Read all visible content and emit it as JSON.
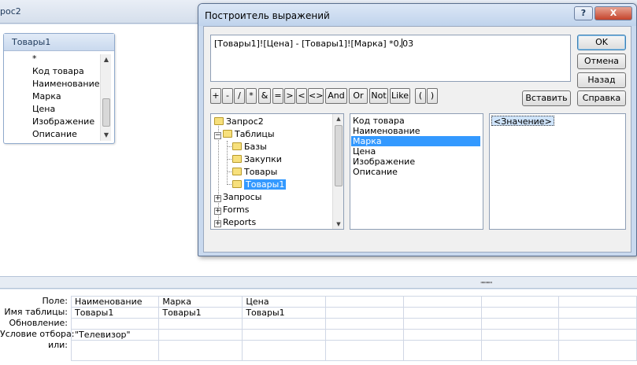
{
  "query_window": {
    "tab_title": "рос2"
  },
  "field_list": {
    "title": "Товары1",
    "items": [
      "*",
      "Код товара",
      "Наименование",
      "Марка",
      "Цена",
      "Изображение",
      "Описание"
    ]
  },
  "design_grid": {
    "row_labels": [
      "Поле:",
      "Имя таблицы:",
      "Обновление:",
      "Условие отбора:",
      "или:"
    ],
    "columns": [
      {
        "field": "Наименование",
        "table": "Товары1",
        "update": "",
        "criteria": "\"Телевизор\"",
        "or": ""
      },
      {
        "field": "Марка",
        "table": "Товары1",
        "update": "",
        "criteria": "",
        "or": ""
      },
      {
        "field": "Цена",
        "table": "Товары1",
        "update": "",
        "criteria": "",
        "or": ""
      },
      {
        "field": "",
        "table": "",
        "update": "",
        "criteria": "",
        "or": ""
      },
      {
        "field": "",
        "table": "",
        "update": "",
        "criteria": "",
        "or": ""
      },
      {
        "field": "",
        "table": "",
        "update": "",
        "criteria": "",
        "or": ""
      },
      {
        "field": "",
        "table": "",
        "update": "",
        "criteria": "",
        "or": ""
      }
    ]
  },
  "dialog": {
    "title": "Построитель выражений",
    "help_label": "?",
    "close_label": "X",
    "expression_before_caret": "[Товары1]![Цена] - [Товары1]![Марка] *0,",
    "expression_after_caret": "03",
    "buttons": {
      "ok": "OK",
      "cancel": "Отмена",
      "back": "Назад",
      "insert": "Вставить",
      "help": "Справка"
    },
    "operators": [
      "+",
      "-",
      "/",
      "*",
      "&",
      "=",
      ">",
      "<",
      "<>",
      "And",
      "Or",
      "Not",
      "Like",
      "(",
      ")"
    ],
    "tree": {
      "items": [
        {
          "label": "Запрос2",
          "icon": "folder-icon"
        },
        {
          "label": "Таблицы",
          "icon": "folder-open-icon",
          "expander": "−"
        },
        {
          "label": "Базы",
          "icon": "folder-icon"
        },
        {
          "label": "Закупки",
          "icon": "folder-icon"
        },
        {
          "label": "Товары",
          "icon": "folder-icon"
        },
        {
          "label": "Товары1",
          "icon": "folder-open-icon",
          "selected": true
        },
        {
          "label": "Запросы",
          "icon": "expand-icon",
          "expander": "+"
        },
        {
          "label": "Forms",
          "icon": "expand-icon",
          "expander": "+"
        },
        {
          "label": "Reports",
          "icon": "expand-icon",
          "expander": "+"
        }
      ]
    },
    "fields_list": [
      "Код товара",
      "Наименование",
      "Марка",
      "Цена",
      "Изображение",
      "Описание"
    ],
    "selected_field": "Марка",
    "values_list": [
      "<Значение>"
    ]
  }
}
